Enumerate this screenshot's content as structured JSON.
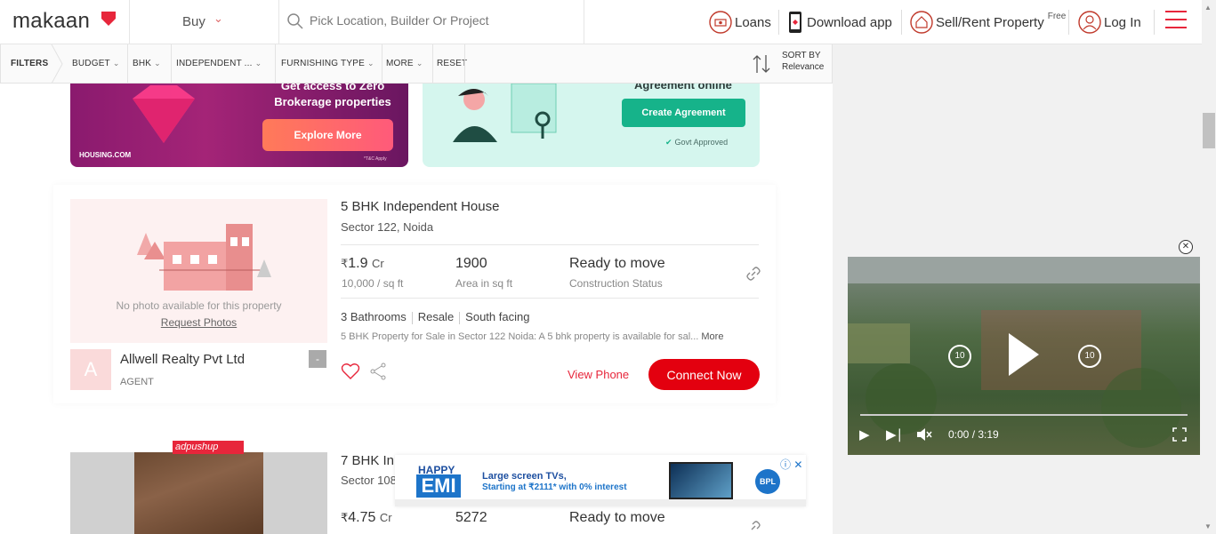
{
  "header": {
    "logo": "makaan",
    "buy_label": "Buy",
    "search_placeholder": "Pick Location, Builder Or Project",
    "loans": "Loans",
    "download_app": "Download app",
    "sell_rent": "Sell/Rent Property",
    "free_badge": "Free",
    "login": "Log In"
  },
  "filters": {
    "label": "FILTERS",
    "items": [
      "BUDGET",
      "BHK",
      "INDEPENDENT ...",
      "FURNISHING TYPE",
      "MORE",
      "RESET"
    ],
    "sort_by": "SORT BY",
    "sort_value": "Relevance"
  },
  "banners": {
    "left_heading_1": "Get access to Zero",
    "left_heading_2": "Brokerage properties",
    "left_button": "Explore More",
    "left_brand": "HOUSING.COM",
    "left_tc": "*T&C Apply",
    "right_heading": "Agreement online",
    "right_button": "Create Agreement",
    "right_badge": "Govt Approved"
  },
  "listing1": {
    "title": "5 BHK Independent House",
    "location": "Sector 122, Noida",
    "price_symbol": "₹",
    "price": "1.9",
    "price_unit": "Cr",
    "price_sub": "10,000 / sq ft",
    "area": "1900",
    "area_sub": "Area in sq ft",
    "status": "Ready to move",
    "status_sub": "Construction Status",
    "features": [
      "3 Bathrooms",
      "Resale",
      "South facing"
    ],
    "description": "5 BHK Property for Sale in Sector 122 Noida: A 5 bhk property is available for sal...",
    "more": "More",
    "no_photo": "No photo available for this property",
    "request_photos": "Request Photos",
    "agent_initial": "A",
    "agent_name": "Allwell Realty Pvt Ltd",
    "agent_role": "AGENT",
    "agent_badge": "-",
    "view_phone": "View Phone",
    "connect": "Connect Now"
  },
  "listing2": {
    "title": "7 BHK In",
    "location": "Sector 108",
    "price_symbol": "₹",
    "price": "4.75",
    "price_unit": "Cr",
    "area": "5272",
    "status": "Ready to move",
    "ad_tag": "adpushup"
  },
  "ad": {
    "happy": "HAPPY",
    "emi": "EMI",
    "line1": "Large screen TVs,",
    "line2": "Starting at ₹2111* with 0% interest",
    "brand": "BPL"
  },
  "video": {
    "time": "0:00 / 3:19",
    "rewind": "10",
    "forward": "10"
  },
  "colors": {
    "brand_red": "#e7263b",
    "connect_red": "#e3000f",
    "banner_magenta": "#a42477",
    "banner_mint": "#d5f6ee"
  }
}
